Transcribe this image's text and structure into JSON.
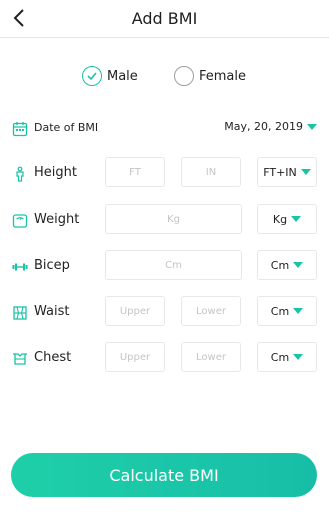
{
  "header": {
    "title": "Add BMI",
    "back_icon": "chevron-left-icon"
  },
  "gender": {
    "selected": "Male",
    "options": [
      {
        "label": "Male",
        "selected": true
      },
      {
        "label": "Female",
        "selected": false
      }
    ]
  },
  "form": {
    "date_of_bmi": {
      "label": "Date of BMI",
      "value": "May, 20, 2019",
      "icon": "calendar-icon"
    },
    "height": {
      "label": "Height",
      "placeholder_ft": "FT",
      "placeholder_in": "IN",
      "unit": "FT+IN",
      "icon": "height-icon"
    },
    "weight": {
      "label": "Weight",
      "placeholder": "Kg",
      "unit": "Kg",
      "icon": "scale-icon"
    },
    "bicep": {
      "label": "Bicep",
      "placeholder": "Cm",
      "unit": "Cm",
      "icon": "bicep-icon"
    },
    "waist": {
      "label": "Waist",
      "placeholder_upper": "Upper",
      "placeholder_lower": "Lower",
      "unit": "Cm",
      "icon": "waist-icon"
    },
    "chest": {
      "label": "Chest",
      "placeholder_upper": "Upper",
      "placeholder_lower": "Lower",
      "unit": "Cm",
      "icon": "chest-icon"
    }
  },
  "actions": {
    "calculate_label": "Calculate BMI"
  },
  "colors": {
    "accent": "#19c3a5",
    "accent_gradient_start": "#1fcfa9",
    "placeholder": "#c5c5c5",
    "border": "#e8e8e8"
  }
}
